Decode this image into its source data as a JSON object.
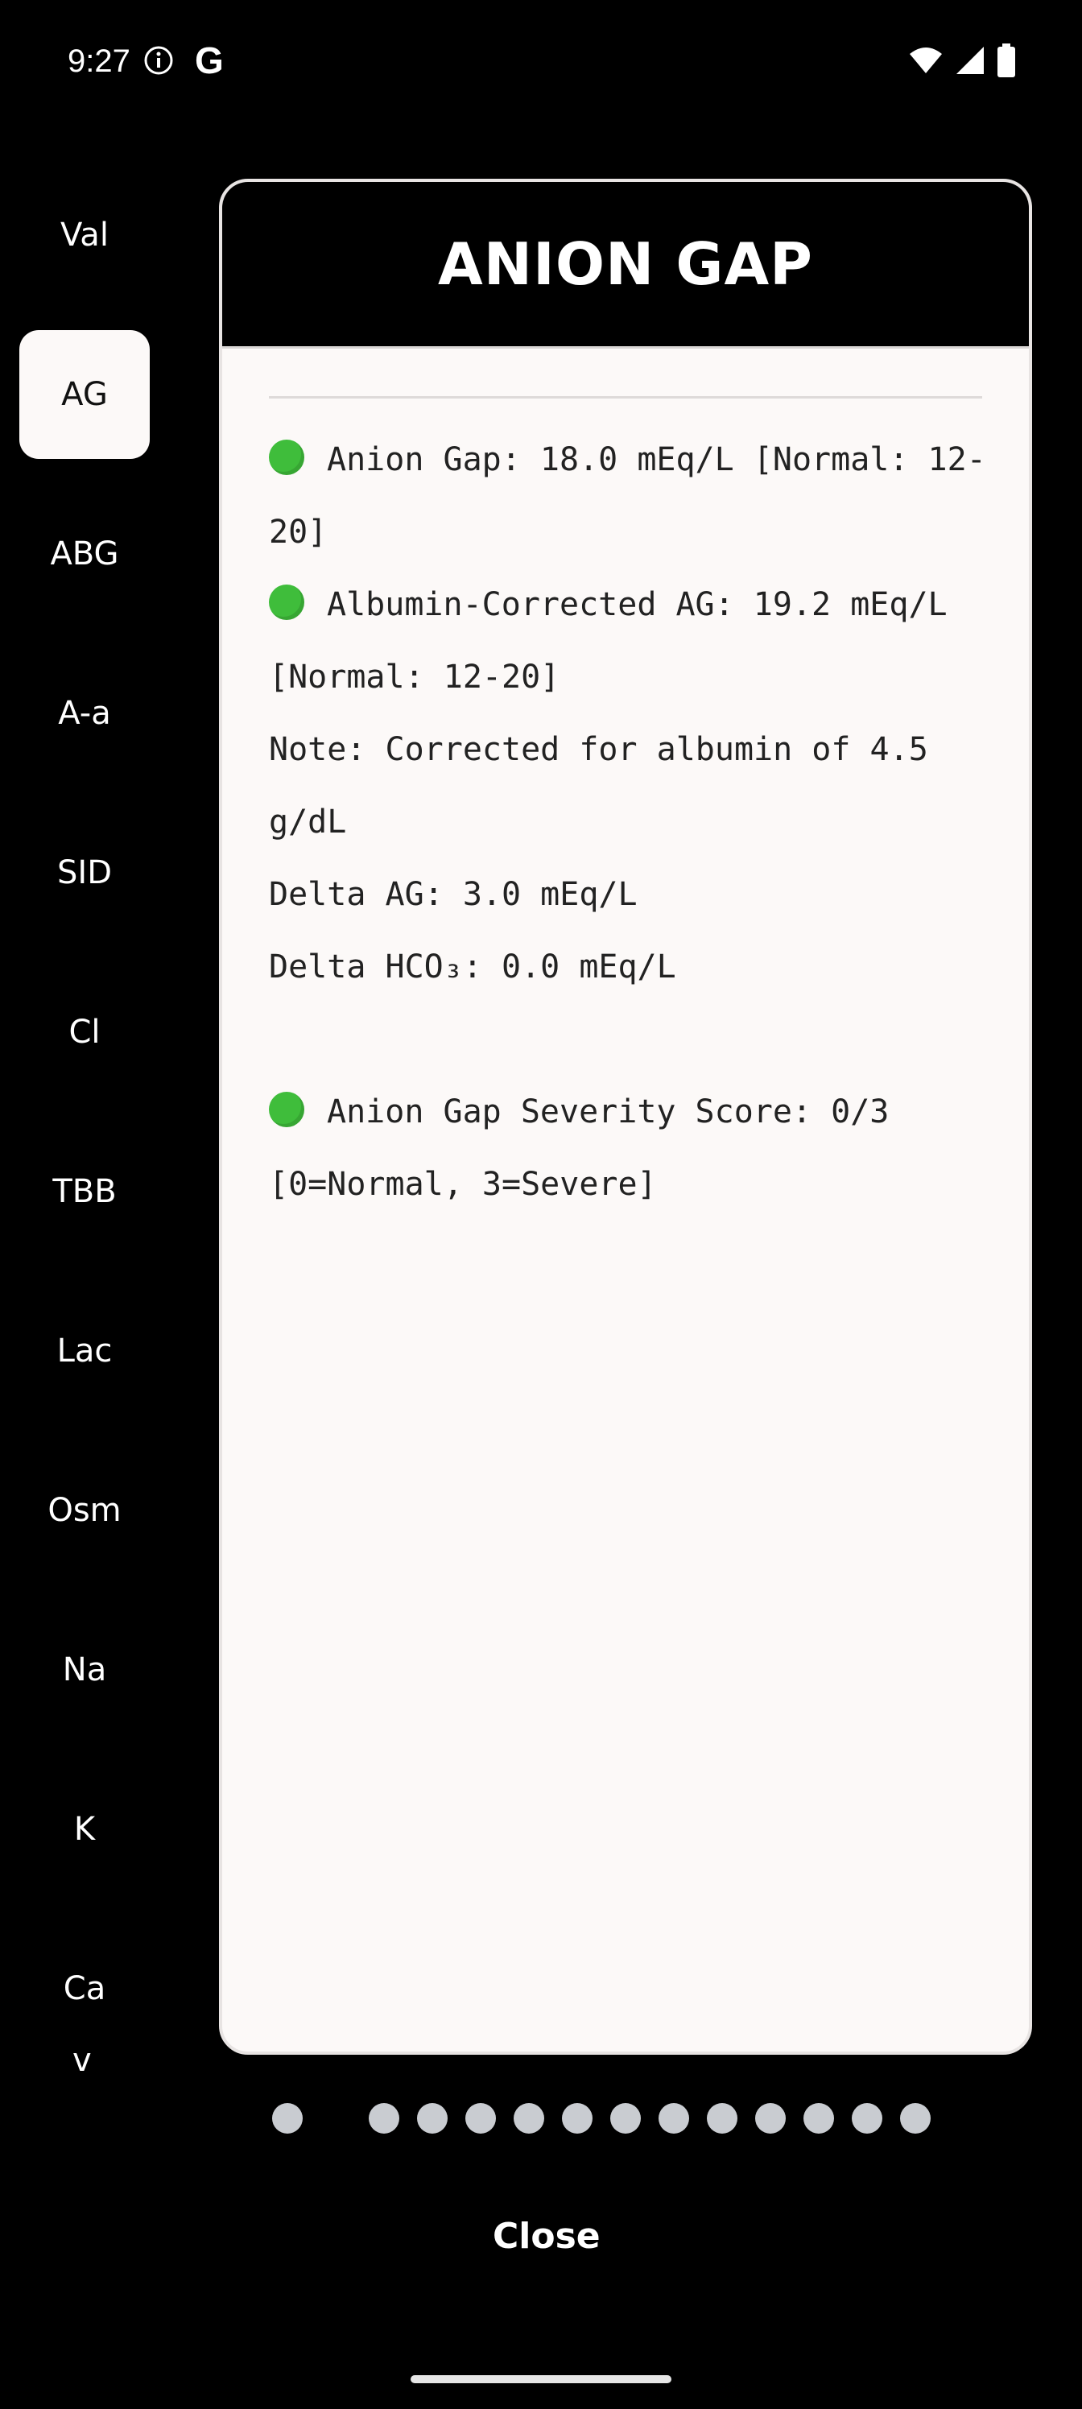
{
  "status_bar": {
    "time": "9:27",
    "info_icon": "info-circle-icon",
    "g_label": "G"
  },
  "sidebar": {
    "items": [
      {
        "label": "Val",
        "active": false
      },
      {
        "label": "AG",
        "active": true
      },
      {
        "label": "ABG",
        "active": false
      },
      {
        "label": "A-a",
        "active": false
      },
      {
        "label": "SID",
        "active": false
      },
      {
        "label": "Cl",
        "active": false
      },
      {
        "label": "TBB",
        "active": false
      },
      {
        "label": "Lac",
        "active": false
      },
      {
        "label": "Osm",
        "active": false
      },
      {
        "label": "Na",
        "active": false
      },
      {
        "label": "K",
        "active": false
      },
      {
        "label": "Ca",
        "active": false
      }
    ],
    "more": "v"
  },
  "card": {
    "title": "ANION GAP",
    "lines": {
      "ag": "Anion Gap: 18.0 mEq/L [Normal: 12-20]",
      "corrected": "Albumin-Corrected AG: 19.2 mEq/L [Normal: 12-20]",
      "note": "Note: Corrected for albumin of 4.5 g/dL",
      "delta_ag": "Delta AG: 3.0 mEq/L",
      "delta_hco3": "Delta HCO₃: 0.0 mEq/L",
      "severity": "Anion Gap Severity Score: 0/3 [0=Normal, 3=Severe]"
    },
    "status_color": "#3fbd3b"
  },
  "pager": {
    "count": 14,
    "current": 2
  },
  "close_label": "Close"
}
